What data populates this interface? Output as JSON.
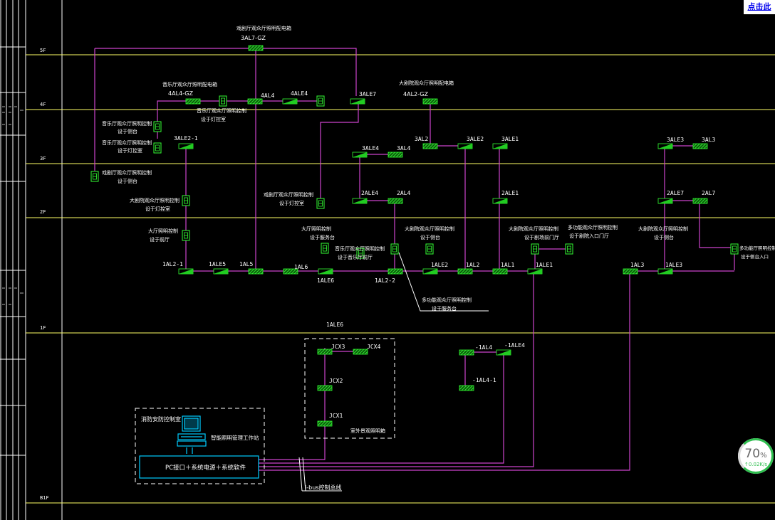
{
  "top_right_link": "点击此",
  "floors": [
    "5F",
    "4F",
    "3F",
    "2F",
    "1F",
    "B1F"
  ],
  "titles": {
    "t5f_a": "戏剧厅观众厅照明配电箱",
    "t5f_b": "3AL7-GZ",
    "t4f_a": "音乐厅观众厅照明配电箱",
    "t4f_b": "4AL4-GZ",
    "t4f_c": "音乐厅观众厅照明控制",
    "t4f_d": "设于灯控室",
    "t4f_e": "大剧院观众厅照明配电箱",
    "t4f_f": "4AL2-GZ",
    "t3f_a": "音乐厅观众厅照明控制",
    "t3f_b": "设于侧台",
    "t3f_c": "音乐厅观众厅照明控制",
    "t3f_d": "设于灯控室",
    "t3f_e": "戏剧厅观众厅照明控制",
    "t3f_f": "设于侧台",
    "t2f_a": "大剧院观众厅照明控制",
    "t2f_b": "设于灯控室",
    "t2f_c": "戏剧厅观众厅照明控制",
    "t2f_d": "设于灯控室",
    "t1f_a": "大厅照明控制",
    "t1f_b": "设于前厅",
    "t1f_c": "大厅照明控制",
    "t1f_d": "设于服务台",
    "t1f_e": "音乐厅观众厅照明控制",
    "t1f_f": "设于音乐厅前厅",
    "t1f_g": "大剧院观众厅照明控制",
    "t1f_h": "设于侧台",
    "t1f_i": "大剧院观众厅照明控制",
    "t1f_j": "设于剧场前门厅",
    "t1f_k": "多功能观众厅照明控制",
    "t1f_l": "设于剧院入口门厅",
    "t1f_m": "大剧院观众厅照明控制",
    "t1f_n": "设于侧台",
    "t1f_o": "多功能厅照明控制",
    "t1f_p": "设于侧台入口",
    "t1f_q": "多功能观众厅照明控制",
    "t1f_r": "设于服务台",
    "b_a": "消防安防控制室",
    "b_b": "智能照明管理工作站",
    "b_c": "PC接口＋系统电源＋系统软件",
    "b_d": "i-bus控制总线",
    "b_e": "室外景观照明箱"
  },
  "labels": {
    "l_4al4": "4AL4",
    "l_4ale4": "4ALE4",
    "l_3ale7": "3ALE7",
    "l_3ale2_1": "3ALE2-1",
    "l_3al2": "3AL2",
    "l_3ale2": "3ALE2",
    "l_3ale1": "3ALE1",
    "l_3ale4": "3ALE4",
    "l_3al4": "3AL4",
    "l_3ale3": "3ALE3",
    "l_3al3": "3AL3",
    "l_2ale4": "2ALE4",
    "l_2al4": "2AL4",
    "l_2ale1": "2ALE1",
    "l_2ale7": "2ALE7",
    "l_2al7": "2AL7",
    "l_1al2_1": "1AL2-1",
    "l_1ale5": "1ALE5",
    "l_1al5": "1AL5",
    "l_1al6": "1AL6",
    "l_1ale6": "1ALE6",
    "l_1al2_2": "1AL2-2",
    "l_1ale2": "1ALE2",
    "l_1al2": "1AL2",
    "l_1al1": "1AL1",
    "l_1ale1": "1ALE1",
    "l_1al3": "1AL3",
    "l_1ale3": "1ALE3",
    "l_1ale6b": "1ALE6",
    "l_jcx3": "JCX3",
    "l_jcx4": "JCX4",
    "l_jcx2": "JCX2",
    "l_jcx1": "JCX1",
    "l_m1al4": "-1AL4",
    "l_m1ale4": "-1ALE4",
    "l_m1al4_1": "-1AL4-1"
  },
  "net_widget": {
    "percent": "70",
    "unit": "%",
    "speed": "↑0.02K/s"
  },
  "colors": {
    "background": "#000000",
    "floor_line": "#ffff66",
    "bus_line": "#cc44cc",
    "box_fill": "#22cc22",
    "box_edge": "#33ff33",
    "label": "#ffffff",
    "frame": "#ffffff",
    "station": "#00ccff",
    "widget_ring": "#2fbf4f"
  },
  "icons": {
    "panel": "hatched-panel-icon",
    "emergency_panel": "emergency-panel-icon",
    "control_panel": "control-panel-icon",
    "workstation": "computer-workstation-icon"
  }
}
